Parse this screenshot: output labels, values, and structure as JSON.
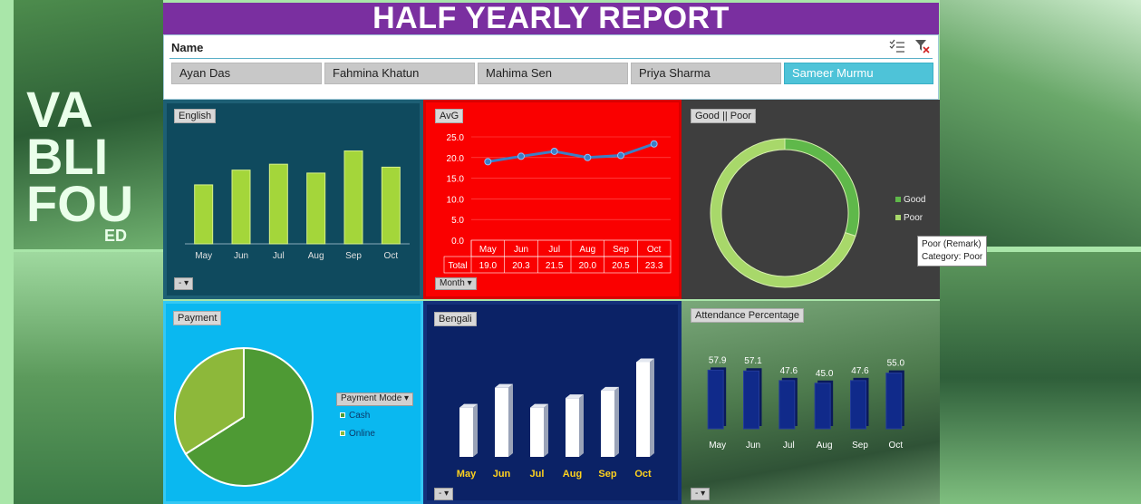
{
  "title": "HALF YEARLY REPORT",
  "slicer": {
    "label": "Name",
    "names": [
      "Ayan Das",
      "Fahmina Khatun",
      "Mahima Sen",
      "Priya Sharma",
      "Sameer Murmu"
    ],
    "selected": "Sameer Murmu"
  },
  "background": {
    "banner_text": [
      "VA",
      "BLI",
      "FOU",
      "ED"
    ]
  },
  "english": {
    "label": "English",
    "dropdown": "-",
    "chart_data": {
      "type": "bar",
      "categories": [
        "May",
        "Jun",
        "Jul",
        "Aug",
        "Sep",
        "Oct"
      ],
      "values": [
        40,
        50,
        54,
        48,
        63,
        52
      ],
      "ylim": [
        0,
        75
      ],
      "title": ""
    }
  },
  "avg": {
    "label": "AvG",
    "dropdown": "Month",
    "chart_data": {
      "type": "line",
      "categories": [
        "May",
        "Jun",
        "Jul",
        "Aug",
        "Sep",
        "Oct"
      ],
      "values": [
        19.0,
        20.3,
        21.5,
        20.0,
        20.5,
        23.3
      ],
      "ylim": [
        0,
        25
      ],
      "yticks": [
        "25.0",
        "20.0",
        "15.0",
        "10.0",
        "5.0",
        "0.0"
      ],
      "table_label": "Total",
      "table_values": [
        "19.0",
        "20.3",
        "21.5",
        "20.0",
        "20.5",
        "23.3"
      ]
    }
  },
  "goodpoor": {
    "label": "Good || Poor",
    "legend": [
      "Good",
      "Poor"
    ],
    "tooltip": [
      "Poor (Remark)",
      "Category: Poor"
    ],
    "chart_data": {
      "type": "pie",
      "labels": [
        "Good",
        "Poor"
      ],
      "values": [
        30,
        70
      ],
      "colors": [
        "#5fb84a",
        "#a8d86a"
      ]
    }
  },
  "payment": {
    "label": "Payment",
    "filter": "Payment Mode",
    "legend": [
      "Cash",
      "Online"
    ],
    "chart_data": {
      "type": "pie",
      "labels": [
        "Cash",
        "Online"
      ],
      "values": [
        66,
        34
      ],
      "colors": [
        "#4e9a34",
        "#8db83a"
      ]
    }
  },
  "bengali": {
    "label": "Bengali",
    "dropdown": "-",
    "chart_data": {
      "type": "bar",
      "categories": [
        "May",
        "Jun",
        "Jul",
        "Aug",
        "Sep",
        "Oct"
      ],
      "values": [
        52,
        73,
        52,
        62,
        70,
        100
      ],
      "ylim": [
        0,
        110
      ]
    }
  },
  "attendance": {
    "label": "Attendance Percentage",
    "dropdown": "-",
    "chart_data": {
      "type": "bar",
      "categories": [
        "May",
        "Jun",
        "Jul",
        "Aug",
        "Sep",
        "Oct"
      ],
      "values": [
        57.9,
        57.1,
        47.6,
        45.0,
        47.6,
        55.0
      ],
      "data_labels": [
        "57.9",
        "57.1",
        "47.6",
        "45.0",
        "47.6",
        "55.0"
      ],
      "ylim": [
        0,
        60
      ]
    }
  }
}
